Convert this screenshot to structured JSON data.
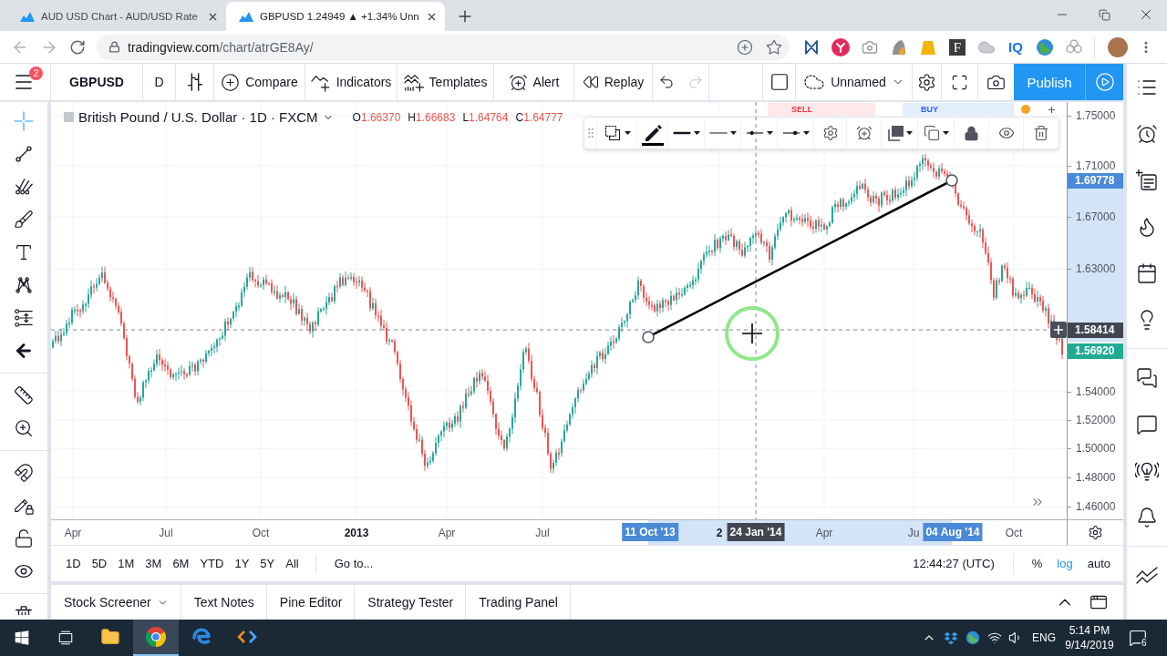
{
  "browser": {
    "tabs": [
      {
        "title": "AUD USD Chart - AUD/USD Rate",
        "selected": false
      },
      {
        "title": "GBPUSD 1.24949 ▲ +1.34% Unn",
        "selected": true
      }
    ],
    "address": {
      "host": "tradingview.com",
      "path": "/chart/atrGE8Ay/"
    },
    "extension_labels": [
      "F",
      "IQ"
    ]
  },
  "toolbar": {
    "menu_badge": "2",
    "symbol": "GBPUSD",
    "interval": "D",
    "buttons": [
      {
        "kind": "compare",
        "label": "Compare"
      },
      {
        "kind": "indicators",
        "label": "Indicators"
      },
      {
        "kind": "templates",
        "label": "Templates"
      },
      {
        "kind": "alert",
        "label": "Alert"
      },
      {
        "kind": "replay",
        "label": "Replay"
      }
    ],
    "history": [
      {
        "kind": "undo",
        "disabled": false
      },
      {
        "kind": "redo",
        "disabled": true
      }
    ],
    "layout_name": "Unnamed",
    "publish_label": "Publish"
  },
  "left_toolbar": {
    "tools": [
      {
        "kind": "cursor",
        "selected": true
      },
      {
        "kind": "trend-line",
        "selected": false
      },
      {
        "kind": "pitchfork",
        "selected": false
      },
      {
        "kind": "brush",
        "selected": false
      },
      {
        "kind": "text",
        "selected": false
      },
      {
        "kind": "pattern",
        "selected": false
      },
      {
        "kind": "projection",
        "selected": false
      },
      {
        "kind": "hide-arrow",
        "selected": false
      },
      {
        "kind": "ruler",
        "selected": false
      },
      {
        "kind": "zoom",
        "selected": false
      },
      {
        "kind": "magnet",
        "selected": false
      },
      {
        "kind": "lock-drawing",
        "selected": false
      },
      {
        "kind": "lock",
        "selected": false
      },
      {
        "kind": "eye",
        "selected": false
      },
      {
        "kind": "trash",
        "selected": false
      }
    ]
  },
  "chart": {
    "title": "British Pound / U.S. Dollar · 1D · FXCM",
    "ohlc": [
      {
        "letter": "O",
        "value": "1.66370"
      },
      {
        "letter": "H",
        "value": "1.66683"
      },
      {
        "letter": "L",
        "value": "1.64764"
      },
      {
        "letter": "C",
        "value": "1.64777"
      }
    ],
    "trade_buttons": [
      {
        "kind": "sell",
        "label": "SELL"
      },
      {
        "kind": "buy",
        "label": "BUY"
      }
    ],
    "price_axis": {
      "ticks": [
        "1.75000",
        "1.71000",
        "1.67000",
        "1.63000",
        "1.54000",
        "1.52000",
        "1.50000",
        "1.48000",
        "1.46000"
      ],
      "markers": [
        {
          "kind": "drawing",
          "text": "1.69778"
        },
        {
          "kind": "crosshair",
          "text": "1.58414"
        },
        {
          "kind": "last-price",
          "text": "1.56920"
        }
      ]
    },
    "time_axis": {
      "ticks": [
        {
          "kind": "month",
          "text": "Apr"
        },
        {
          "kind": "month",
          "text": "Jul"
        },
        {
          "kind": "month",
          "text": "Oct"
        },
        {
          "kind": "year",
          "text": "2013"
        },
        {
          "kind": "month",
          "text": "Apr"
        },
        {
          "kind": "month",
          "text": "Jul"
        },
        {
          "kind": "year",
          "text": "2"
        },
        {
          "kind": "month",
          "text": "Apr"
        },
        {
          "kind": "month",
          "text": "Ju"
        },
        {
          "kind": "month",
          "text": "Oct"
        }
      ],
      "markers": [
        {
          "kind": "drawing-start",
          "text": "11 Oct '13"
        },
        {
          "kind": "crosshair",
          "text": "24 Jan '14"
        },
        {
          "kind": "drawing-end",
          "text": "04 Aug '14"
        }
      ]
    }
  },
  "range_bar": {
    "ranges": [
      "1D",
      "5D",
      "1M",
      "3M",
      "6M",
      "YTD",
      "1Y",
      "5Y",
      "All"
    ],
    "goto_label": "Go to...",
    "clock": "12:44:27 (UTC)",
    "scale_options": [
      {
        "label": "%",
        "selected": false
      },
      {
        "label": "log",
        "selected": true
      },
      {
        "label": "auto",
        "selected": false
      }
    ]
  },
  "bottom_panel": {
    "tabs": [
      {
        "label": "Stock Screener",
        "dropdown": true
      },
      {
        "label": "Text Notes",
        "dropdown": false
      },
      {
        "label": "Pine Editor",
        "dropdown": false
      },
      {
        "label": "Strategy Tester",
        "dropdown": false
      },
      {
        "label": "Trading Panel",
        "dropdown": false
      }
    ]
  },
  "taskbar": {
    "apps": [
      {
        "kind": "folder",
        "selected": false
      },
      {
        "kind": "tricolor",
        "selected": true
      },
      {
        "kind": "swirl",
        "selected": false
      },
      {
        "kind": "brackets",
        "selected": false
      }
    ],
    "language": "ENG",
    "time": "5:14 PM",
    "date": "9/14/2019",
    "notification_count": "6"
  }
}
